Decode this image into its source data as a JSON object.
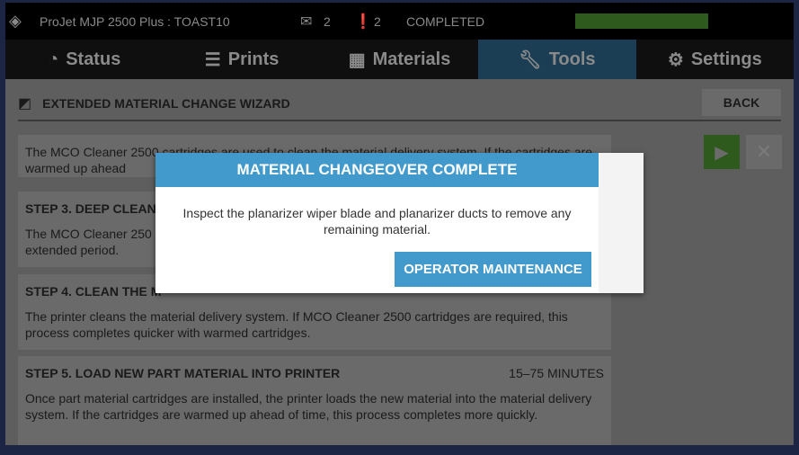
{
  "topbar": {
    "printer": "ProJet MJP 2500 Plus : TOAST10",
    "messages": "2",
    "alerts": "2",
    "status": "COMPLETED",
    "progress": 100,
    "progress_color": "#2f5a1e"
  },
  "tabs": [
    {
      "label": "Status",
      "icon": "clock-icon"
    },
    {
      "label": "Prints",
      "icon": "list-icon"
    },
    {
      "label": "Materials",
      "icon": "checker-icon"
    },
    {
      "label": "Tools",
      "icon": "wrench-icon",
      "active": true
    },
    {
      "label": "Settings",
      "icon": "gear-icon"
    }
  ],
  "header": {
    "title": "EXTENDED MATERIAL CHANGE WIZARD",
    "back": "BACK"
  },
  "steps": [
    {
      "title": "",
      "time": "",
      "text": "The MCO Cleaner 2500 cartridges are used to clean the material delivery system. If the cartridges are warmed up ahead"
    },
    {
      "title": "STEP 3. DEEP CLEAN",
      "time": "",
      "text": "The MCO Cleaner 250 extended period."
    },
    {
      "title": "STEP 4. CLEAN THE M",
      "time": "",
      "text": "The printer cleans the material delivery system. If MCO Cleaner 2500 cartridges are required, this process completes quicker with warmed cartridges."
    },
    {
      "title": "STEP 5. LOAD NEW PART MATERIAL INTO PRINTER",
      "time": "15–75 MINUTES",
      "text": "Once part material cartridges are installed, the printer loads the new material into the material delivery system. If the cartridges are warmed up ahead of time, this process completes more quickly."
    }
  ],
  "modal": {
    "title": "MATERIAL CHANGEOVER COMPLETE",
    "body": "Inspect the planarizer wiper blade and planarizer ducts to remove any remaining material.",
    "button": "OPERATOR MAINTENANCE"
  },
  "colors": {
    "accent": "#4199cc"
  }
}
